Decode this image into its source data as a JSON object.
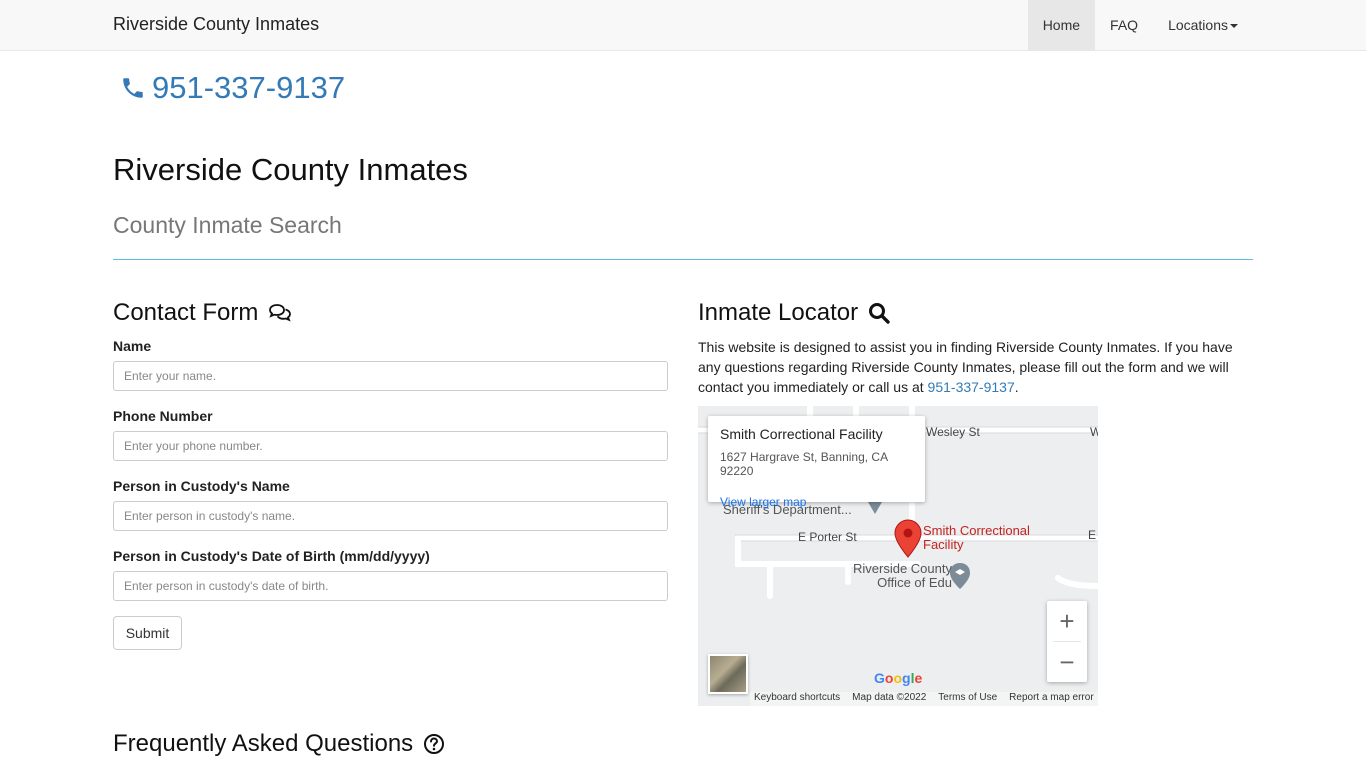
{
  "navbar": {
    "brand": "Riverside County Inmates",
    "items": [
      "Home",
      "FAQ",
      "Locations"
    ]
  },
  "phone": "951-337-9137",
  "page_title": "Riverside County Inmates",
  "subtitle": "County Inmate Search",
  "contact": {
    "heading": "Contact Form",
    "fields": [
      {
        "label": "Name",
        "placeholder": "Enter your name."
      },
      {
        "label": "Phone Number",
        "placeholder": "Enter your phone number."
      },
      {
        "label": "Person in Custody's Name",
        "placeholder": "Enter person in custody's name."
      },
      {
        "label": "Person in Custody's Date of Birth (mm/dd/yyyy)",
        "placeholder": "Enter person in custody's date of birth."
      }
    ],
    "submit": "Submit"
  },
  "locator": {
    "heading": "Inmate Locator",
    "text_before": "This website is designed to assist you in finding Riverside County Inmates. If you have any questions regarding Riverside County Inmates, please fill out the form and we will contact you immediately or call us at ",
    "phone_link": "951-337-9137",
    "text_after": "."
  },
  "map": {
    "card_title": "Smith Correctional Facility",
    "card_address": "1627 Hargrave St, Banning, CA 92220",
    "card_link": "View larger map",
    "labels": {
      "wesley": "Wesley St",
      "w": "W",
      "sheriff": "Sheriff's Department...",
      "porter": "E Porter St",
      "e1": "E",
      "facility_line1": "Smith Correctional",
      "facility_line2": "Facility",
      "office_line1": "Riverside County",
      "office_line2": "Office of Edu"
    },
    "zoom_in": "+",
    "zoom_out": "−",
    "google": "Google",
    "attribution": [
      "Keyboard shortcuts",
      "Map data ©2022",
      "Terms of Use",
      "Report a map error"
    ]
  },
  "faq": {
    "heading": "Frequently Asked Questions"
  }
}
